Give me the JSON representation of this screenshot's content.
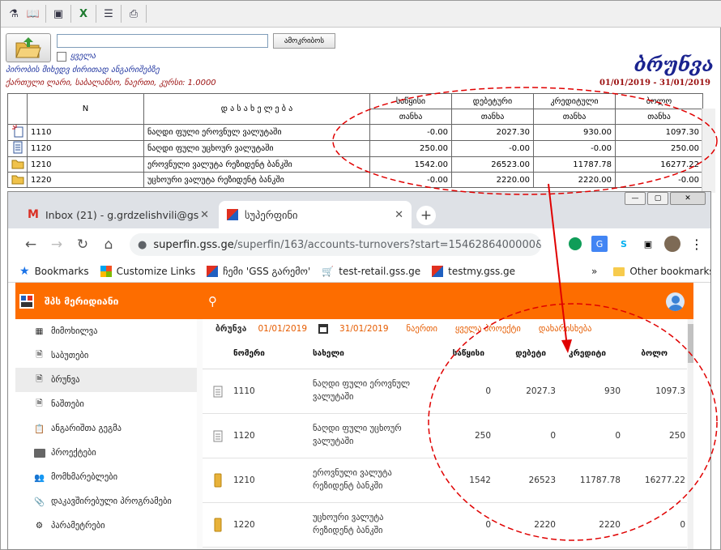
{
  "legacy": {
    "find_button": "ამოკრიბოს",
    "all_checkbox": "ყველა",
    "info_line1": "პირობის მიხედვ ძირითად ანგარიშებზე",
    "info_line2": "ქართული ლარი,  საბალანსო, ნაერთი, კურსი: 1.0000",
    "title": "ბრუნვა",
    "period": "01/01/2019 - 31/01/2019",
    "table": {
      "headers": {
        "n": "N",
        "name": "დ ა ს ა ხ ე ლ ე ბ ა",
        "start": "საწყისი",
        "debit": "დებეტური",
        "credit": "კრედიტული",
        "end": "ბოლო"
      },
      "subheader": "თანხა",
      "rows": [
        {
          "icon": "new-document-icon",
          "n": "1110",
          "name": "ნაღდი ფული ეროვნულ ვალუტაში",
          "start": "-0.00",
          "debit": "2027.30",
          "credit": "930.00",
          "end": "1097.30"
        },
        {
          "icon": "document-icon",
          "n": "1120",
          "name": "ნაღდი ფული უცხოურ ვალუტაში",
          "start": "250.00",
          "debit": "-0.00",
          "credit": "-0.00",
          "end": "250.00"
        },
        {
          "icon": "folder-icon",
          "n": "1210",
          "name": "ეროვნული ვალუტა რეზიდენტ ბანკში",
          "start": "1542.00",
          "debit": "26523.00",
          "credit": "11787.78",
          "end": "16277.22"
        },
        {
          "icon": "folder-icon",
          "n": "1220",
          "name": "უცხოური ვალუტა რეზიდენტ ბანკში",
          "start": "-0.00",
          "debit": "2220.00",
          "credit": "2220.00",
          "end": "-0.00"
        }
      ]
    }
  },
  "browser": {
    "tabs": [
      {
        "label": "Inbox (21) - g.grdzelishvili@gss.g"
      },
      {
        "label": "სუპერფინი"
      }
    ],
    "url_host": "superfin.gss.ge",
    "url_path": "/superfin/163/accounts-turnovers?start=1546286400000&en...",
    "bookmarks": [
      {
        "label": "Bookmarks"
      },
      {
        "label": "Customize Links"
      },
      {
        "label": "ჩემი 'GSS გარემო'"
      },
      {
        "label": "test-retail.gss.ge"
      },
      {
        "label": "testmy.gss.ge"
      }
    ],
    "other_bookmarks": "Other bookmarks",
    "more": "»"
  },
  "app": {
    "title": "შპს მერიდიანი",
    "accent_color": "#fd6d00",
    "menu": [
      {
        "label": "მიმოხილვა",
        "icon": "dashboard-icon"
      },
      {
        "label": "საბუთები",
        "icon": "documents-icon"
      },
      {
        "label": "ბრუნვა",
        "icon": "turnover-icon"
      },
      {
        "label": "ნაშთები",
        "icon": "balances-icon"
      },
      {
        "label": "ანგარიშთა გეგმა",
        "icon": "accounts-plan-icon"
      },
      {
        "label": "პროექტები",
        "icon": "folder-icon"
      },
      {
        "label": "მომხმარებლები",
        "icon": "users-icon"
      },
      {
        "label": "დაკავშირებული პროგრამები",
        "icon": "attachment-icon"
      },
      {
        "label": "პარამეტრები",
        "icon": "settings-icon"
      }
    ],
    "filter": {
      "label": "ბრუნვა",
      "date_from": "01/01/2019",
      "date_to": "31/01/2019",
      "link1": "ნაერთი",
      "link2": "ყველა პროექტი",
      "link3": "დახარისხება"
    },
    "columns": {
      "number": "ნომერი",
      "name": "სახელი",
      "start": "საწყისი",
      "debit": "დებეტი",
      "credit": "კრედიტი",
      "end": "ბოლო"
    },
    "rows": [
      {
        "icon": "document-icon",
        "number": "1110",
        "name": "ნაღდი ფული ეროვნულ ვალუტაში",
        "start": "0",
        "debit": "2027.3",
        "credit": "930",
        "end": "1097.3"
      },
      {
        "icon": "document-icon",
        "number": "1120",
        "name": "ნაღდი ფული უცხოურ ვალუტაში",
        "start": "250",
        "debit": "0",
        "credit": "0",
        "end": "250"
      },
      {
        "icon": "folder-icon",
        "number": "1210",
        "name": "ეროვნული ვალუტა რეზიდენტ ბანკში",
        "start": "1542",
        "debit": "26523",
        "credit": "11787.78",
        "end": "16277.22"
      },
      {
        "icon": "folder-icon",
        "number": "1220",
        "name": "უცხოური ვალუტა რეზიდენტ ბანკში",
        "start": "0",
        "debit": "2220",
        "credit": "2220",
        "end": "0"
      }
    ]
  }
}
